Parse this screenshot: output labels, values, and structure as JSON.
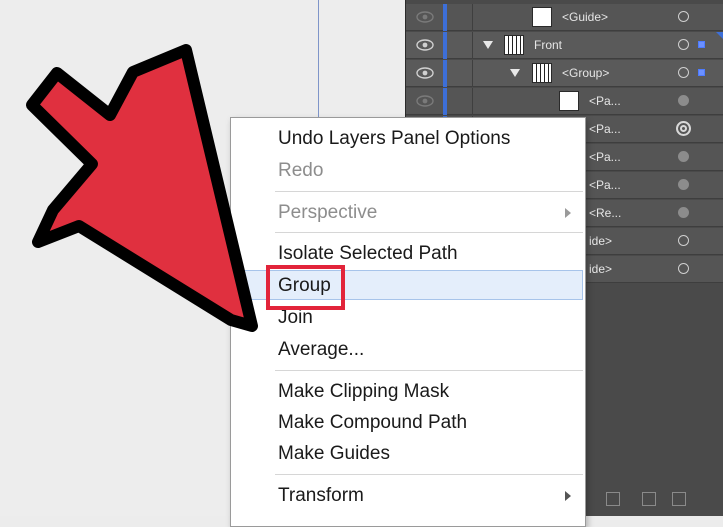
{
  "layers": {
    "rows": [
      {
        "name": "<Guide>",
        "thumb": "blank",
        "twisty": false,
        "selected": false
      },
      {
        "name": "Front",
        "thumb": "striped",
        "twisty": true,
        "selected": true
      },
      {
        "name": "<Group>",
        "thumb": "striped",
        "twisty": true,
        "selected": true
      },
      {
        "name": "<Pa...",
        "thumb": "blank",
        "twisty": false,
        "selected": false
      },
      {
        "name": "<Pa...",
        "thumb": "blank",
        "twisty": false,
        "selected": false
      },
      {
        "name": "<Pa...",
        "thumb": "blank",
        "twisty": false,
        "selected": false
      },
      {
        "name": "<Pa...",
        "thumb": "blank",
        "twisty": false,
        "selected": false
      },
      {
        "name": "<Re...",
        "thumb": "blank",
        "twisty": false,
        "selected": false
      },
      {
        "name": "ide>",
        "thumb": "blank",
        "twisty": false,
        "selected": false
      },
      {
        "name": "ide>",
        "thumb": "blank",
        "twisty": false,
        "selected": false
      }
    ]
  },
  "menu": {
    "undo": "Undo Layers Panel Options",
    "redo": "Redo",
    "perspective": "Perspective",
    "isolate": "Isolate Selected Path",
    "group": "Group",
    "join": "Join",
    "average": "Average...",
    "clipping": "Make Clipping Mask",
    "compound": "Make Compound Path",
    "guides": "Make Guides",
    "transform": "Transform"
  },
  "colors": {
    "arrow_fill": "#e0303f",
    "highlight_box": "#e2243a",
    "menu_hover": "#e4eefb"
  }
}
